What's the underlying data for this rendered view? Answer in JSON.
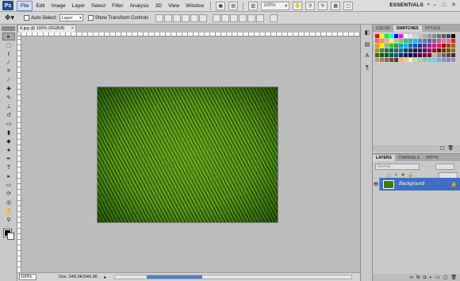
{
  "app": {
    "logo": "Ps",
    "workspace": "ESSENTIALS"
  },
  "menu": [
    "File",
    "Edit",
    "Image",
    "Layer",
    "Select",
    "Filter",
    "Analysis",
    "3D",
    "View",
    "Window"
  ],
  "menubar_zoom": "100%",
  "window_buttons": [
    "–",
    "□",
    "✕"
  ],
  "options": {
    "auto_select_label": "Auto-Select:",
    "auto_select_value": "Layer",
    "transform_label": "Show Transform Controls"
  },
  "document": {
    "tab_title": "4.jpg @ 100% (RGB/8)",
    "close": "×"
  },
  "status": {
    "zoom": "100%",
    "doc_info": "Doc: 549.3K/549.3K"
  },
  "panels": {
    "top_tabs": [
      "COLOR",
      "SWATCHES",
      "STYLES"
    ],
    "layer_tabs": [
      "LAYERS",
      "CHANNELS",
      "PATHS"
    ],
    "blend_mode": "Normal",
    "layer_name": "Background"
  },
  "swatch_colors": [
    "#ff0000",
    "#ffff00",
    "#00ff00",
    "#00ffff",
    "#0000ff",
    "#ff00ff",
    "#ffffff",
    "#ebebeb",
    "#d6d6d6",
    "#c2c2c2",
    "#adadad",
    "#999999",
    "#858585",
    "#707070",
    "#5c5c5c",
    "#474747",
    "#000000",
    "#f26c4f",
    "#f68e55",
    "#fbaf5c",
    "#fff467",
    "#acd372",
    "#7cc576",
    "#3bb878",
    "#1abbb4",
    "#00bff3",
    "#438ccb",
    "#5574b9",
    "#605ca8",
    "#855fa8",
    "#a763a8",
    "#f06ea9",
    "#f26d7d",
    "#ed1c24",
    "#f7941d",
    "#fff200",
    "#8dc63f",
    "#39b54a",
    "#00a651",
    "#00a99d",
    "#00aeef",
    "#0072bc",
    "#0054a6",
    "#2e3192",
    "#662d91",
    "#92278f",
    "#ec008c",
    "#ed145b",
    "#9e0b0f",
    "#a0410d",
    "#a36209",
    "#aba000",
    "#598527",
    "#1a7b30",
    "#007236",
    "#00746b",
    "#0076a3",
    "#004a80",
    "#003471",
    "#1b1464",
    "#440e62",
    "#630460",
    "#9e005d",
    "#9e0039",
    "#790000",
    "#7b2e00",
    "#7d4900",
    "#827b00",
    "#406618",
    "#005e20",
    "#005826",
    "#005952",
    "#005b7f",
    "#003663",
    "#002157",
    "#0d004c",
    "#32004b",
    "#4b0049",
    "#7b0046",
    "#7a0026",
    "#c7b299",
    "#998675",
    "#736357",
    "#534741",
    "#37302a",
    "#c69c6d",
    "#a67c52",
    "#8c6239",
    "#754c24",
    "#603913",
    "#f9ad81",
    "#fdc689",
    "#fff799",
    "#c4df9b",
    "#a3d39c",
    "#82ca9c",
    "#7accc8",
    "#6dcff6",
    "#7da7d9",
    "#8393ca",
    "#8781bd",
    "#a186be"
  ]
}
